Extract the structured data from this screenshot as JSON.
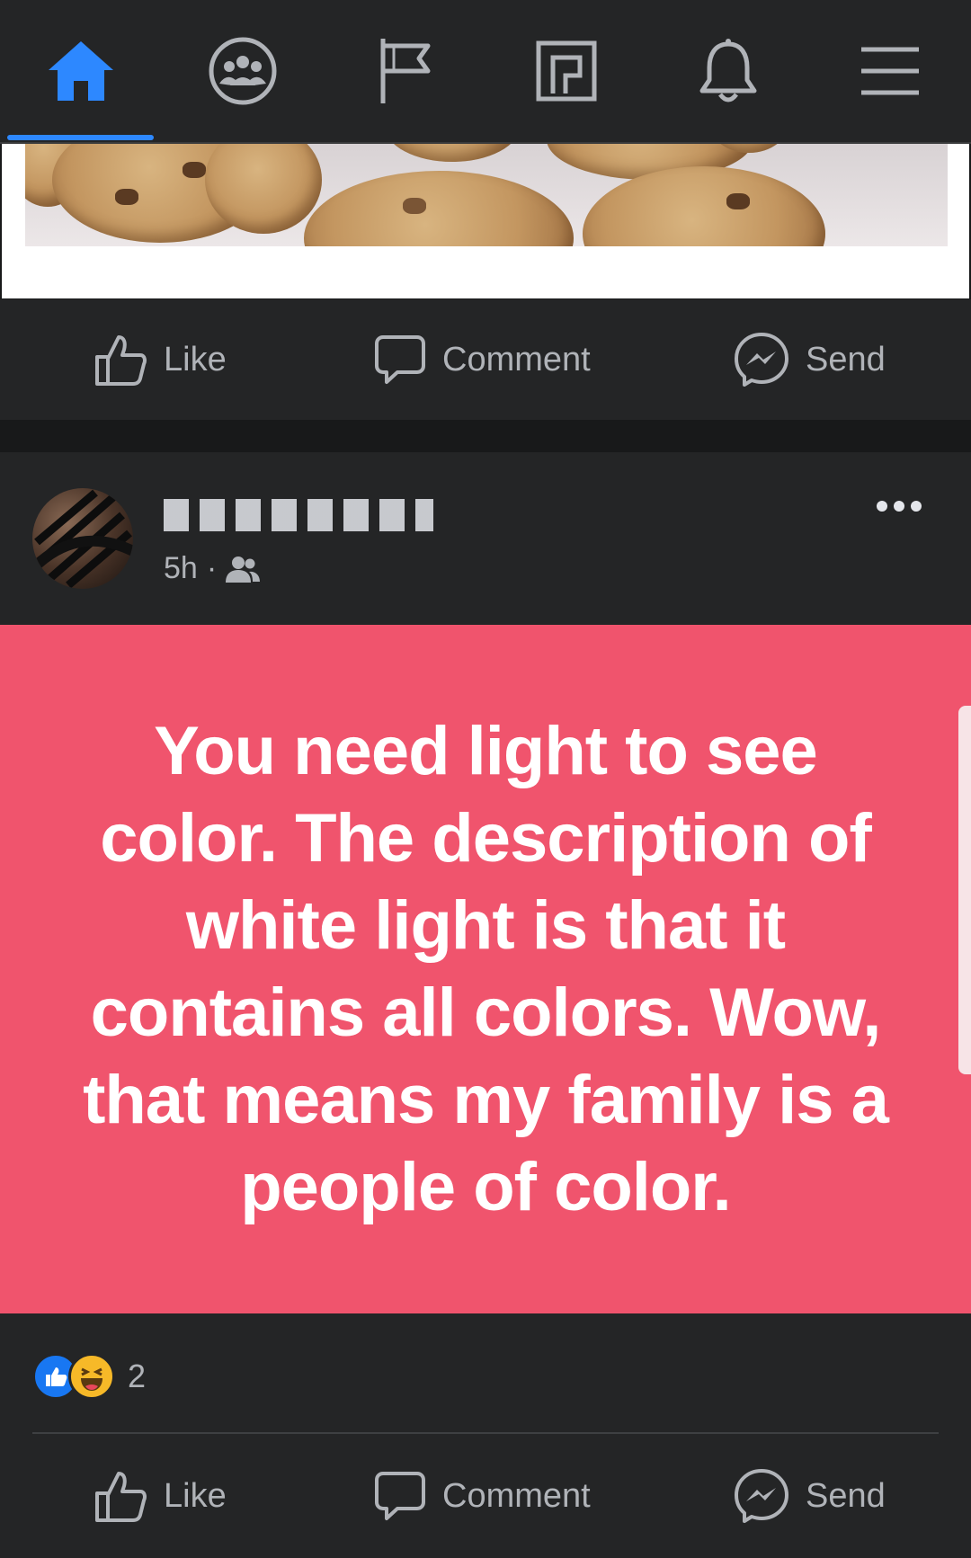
{
  "nav": {
    "items": [
      {
        "icon": "home-icon",
        "active": true
      },
      {
        "icon": "groups-icon",
        "active": false
      },
      {
        "icon": "pages-flag-icon",
        "active": false
      },
      {
        "icon": "watch-icon",
        "active": false
      },
      {
        "icon": "bell-icon",
        "active": false
      },
      {
        "icon": "menu-icon",
        "active": false
      }
    ],
    "active_color": "#2d88ff"
  },
  "previous_post": {
    "image": "cookies-photo",
    "actions": {
      "like": "Like",
      "comment": "Comment",
      "send": "Send"
    }
  },
  "post": {
    "author_name": "",
    "time": "5h",
    "audience_icon": "friends-icon",
    "more_icon": "more-dots-icon",
    "background_color": "#f0546d",
    "text": "You need light to see color. The description of white light is that it contains all colors. Wow, that means my family is a people of color.",
    "reactions": {
      "icons": [
        "like-reaction-icon",
        "haha-reaction-icon"
      ],
      "count": "2"
    },
    "actions": {
      "like": "Like",
      "comment": "Comment",
      "send": "Send"
    }
  }
}
